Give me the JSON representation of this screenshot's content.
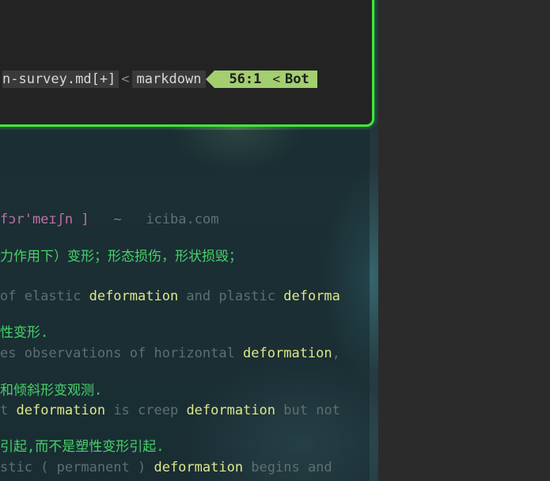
{
  "editor": {
    "status": {
      "filename": "n-survey.md[+]",
      "separator": "<",
      "filetype": "markdown",
      "position": "56:1",
      "pct_separator": "<",
      "percent": "Bot"
    }
  },
  "dict": {
    "phonetic": "fɔr'meɪʃn ]",
    "tilde": "~",
    "source": "iciba.com",
    "definition": "力作用下）变形；形态损伤，形状损毁；",
    "examples": [
      {
        "en_parts": [
          "of elastic ",
          "deformation",
          " and plastic ",
          "deforma"
        ],
        "cn": "性变形."
      },
      {
        "en_parts": [
          "es observations of horizontal ",
          "deformation",
          ","
        ],
        "cn": "和倾斜形变观测."
      },
      {
        "en_parts": [
          "t ",
          "deformation",
          " is creep ",
          "deformation",
          " but not"
        ],
        "cn": "引起,而不是塑性变形引起."
      },
      {
        "en_parts": [
          "stic ( permanent ) ",
          "deformation",
          " begins and"
        ],
        "cn": ""
      }
    ]
  }
}
